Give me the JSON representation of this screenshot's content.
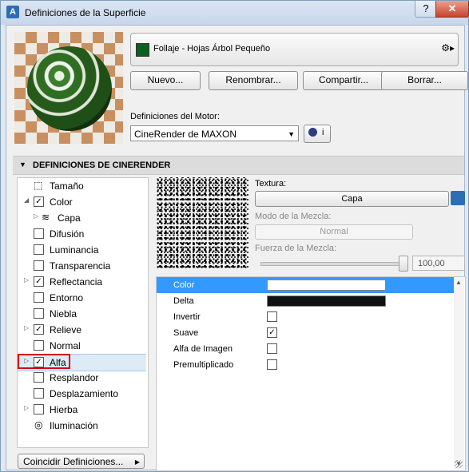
{
  "window": {
    "title": "Definiciones de la Superficie",
    "help_label": "?",
    "close_label": "✕"
  },
  "material": {
    "name": "Follaje - Hojas Árbol Pequeño",
    "swatch_color": "#0d5f1e",
    "menu_icon": "▸"
  },
  "actions": {
    "new_label": "Nuevo...",
    "rename_label": "Renombrar...",
    "share_label": "Compartir...",
    "delete_label": "Borrar..."
  },
  "engine": {
    "label": "Definiciones del Motor:",
    "value": "CineRender de MAXON",
    "info_label": "i"
  },
  "section": {
    "title": "DEFINICIONES DE CINERENDER"
  },
  "channels": [
    {
      "label": "Tamaño",
      "icon": "size-icon",
      "expandable": false,
      "checked": null
    },
    {
      "label": "Color",
      "expandable": true,
      "expanded": true,
      "checked": true
    },
    {
      "label": "Capa",
      "icon": "layers-icon",
      "expandable": true,
      "checked": null,
      "indent": true
    },
    {
      "label": "Difusión",
      "expandable": false,
      "checked": false
    },
    {
      "label": "Luminancia",
      "expandable": false,
      "checked": false
    },
    {
      "label": "Transparencia",
      "expandable": false,
      "checked": false
    },
    {
      "label": "Reflectancia",
      "expandable": true,
      "checked": true
    },
    {
      "label": "Entorno",
      "expandable": false,
      "checked": false
    },
    {
      "label": "Niebla",
      "expandable": false,
      "checked": false
    },
    {
      "label": "Relieve",
      "expandable": true,
      "checked": true
    },
    {
      "label": "Normal",
      "expandable": false,
      "checked": false
    },
    {
      "label": "Alfa",
      "expandable": true,
      "checked": true,
      "selected": true
    },
    {
      "label": "Resplandor",
      "expandable": false,
      "checked": false
    },
    {
      "label": "Desplazamiento",
      "expandable": false,
      "checked": false
    },
    {
      "label": "Hierba",
      "expandable": true,
      "checked": false
    },
    {
      "label": "Iluminación",
      "icon": "lighting-icon",
      "expandable": false,
      "checked": null
    }
  ],
  "match_button_label": "Coincidir Definiciones...",
  "texture": {
    "label": "Textura:",
    "button_label": "Capa",
    "blend_mode_label": "Modo de la Mezcla:",
    "blend_mode_value": "Normal",
    "blend_strength_label": "Fuerza de la Mezcla:",
    "blend_strength_value": "100,00",
    "blend_strength_fraction": 1.0
  },
  "properties": [
    {
      "label": "Color",
      "type": "color",
      "value": "#ffffff",
      "selected": true
    },
    {
      "label": "Delta",
      "type": "color",
      "value": "#111111"
    },
    {
      "label": "Invertir",
      "type": "checkbox",
      "checked": false
    },
    {
      "label": "Suave",
      "type": "checkbox",
      "checked": true
    },
    {
      "label": "Alfa de Imagen",
      "type": "checkbox",
      "checked": false
    },
    {
      "label": "Premultiplicado",
      "type": "checkbox",
      "checked": false
    }
  ]
}
